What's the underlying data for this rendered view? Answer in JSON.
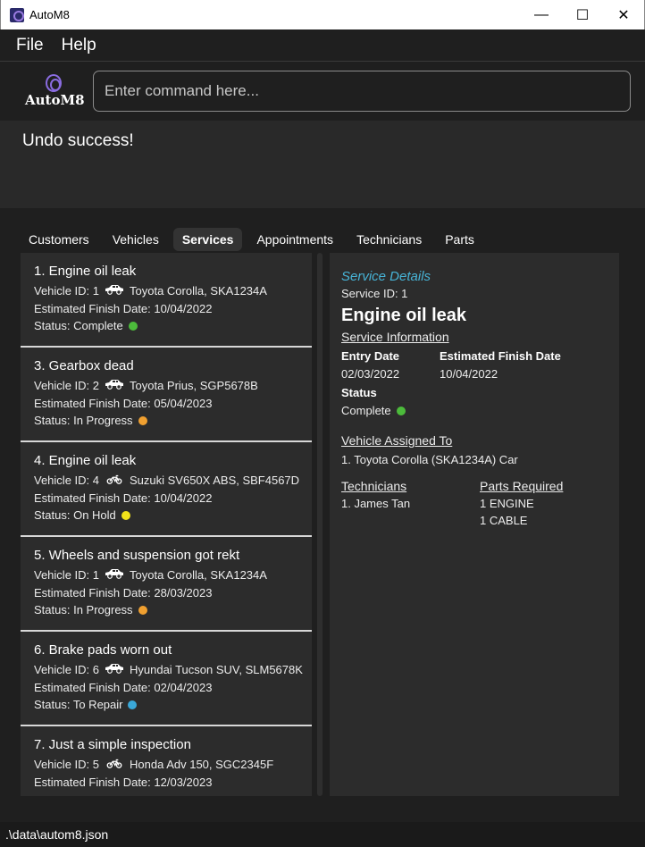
{
  "window": {
    "title": "AutoM8",
    "controls": [
      "—",
      "☐",
      "✕"
    ]
  },
  "menu": {
    "file": "File",
    "help": "Help"
  },
  "logo_text": "AutoM8",
  "command": {
    "placeholder": "Enter command here..."
  },
  "result": "Undo success!",
  "tabs": [
    "Customers",
    "Vehicles",
    "Services",
    "Appointments",
    "Technicians",
    "Parts"
  ],
  "active_tab": "Services",
  "services": [
    {
      "title": "1.  Engine oil leak",
      "vehicle": "Vehicle ID: 1",
      "vehicle_type": "car",
      "vehicle_name": "Toyota Corolla, SKA1234A",
      "finish": "Estimated Finish Date: 10/04/2022",
      "status": "Status: Complete",
      "status_color": "#4cbb3b"
    },
    {
      "title": "3.  Gearbox dead",
      "vehicle": "Vehicle ID: 2",
      "vehicle_type": "car",
      "vehicle_name": "Toyota Prius, SGP5678B",
      "finish": "Estimated Finish Date: 05/04/2023",
      "status": "Status: In Progress",
      "status_color": "#f0a030"
    },
    {
      "title": "4.  Engine oil leak",
      "vehicle": "Vehicle ID: 4",
      "vehicle_type": "bike",
      "vehicle_name": "Suzuki SV650X ABS, SBF4567D",
      "finish": "Estimated Finish Date: 10/04/2022",
      "status": "Status: On Hold",
      "status_color": "#f2e21a"
    },
    {
      "title": "5.  Wheels and suspension got rekt",
      "vehicle": "Vehicle ID: 1",
      "vehicle_type": "car",
      "vehicle_name": "Toyota Corolla, SKA1234A",
      "finish": "Estimated Finish Date: 28/03/2023",
      "status": "Status: In Progress",
      "status_color": "#f0a030"
    },
    {
      "title": "6.  Brake pads worn out",
      "vehicle": "Vehicle ID: 6",
      "vehicle_type": "car",
      "vehicle_name": "Hyundai Tucson SUV, SLM5678K",
      "finish": "Estimated Finish Date: 02/04/2023",
      "status": "Status: To Repair",
      "status_color": "#3aa8d8"
    },
    {
      "title": "7.  Just a simple inspection",
      "vehicle": "Vehicle ID: 5",
      "vehicle_type": "bike",
      "vehicle_name": "Honda Adv 150, SGC2345F",
      "finish": "Estimated Finish Date: 12/03/2023",
      "status": "",
      "status_color": ""
    }
  ],
  "details": {
    "header": "Service Details",
    "service_id": "Service ID: 1",
    "title": "Engine oil leak",
    "info_label": "Service Information",
    "entry_date_label": "Entry Date",
    "entry_date": "02/03/2022",
    "finish_label": "Estimated Finish Date",
    "finish_date": "10/04/2022",
    "status_label": "Status",
    "status": "Complete",
    "status_color": "#4cbb3b",
    "vehicle_label": "Vehicle Assigned To",
    "vehicle": "1. Toyota Corolla (SKA1234A) Car",
    "technicians_label": "Technicians",
    "technicians": [
      "1. James Tan"
    ],
    "parts_label": "Parts Required",
    "parts": [
      "1 ENGINE",
      "1 CABLE"
    ]
  },
  "statusbar": ".\\data\\autom8.json"
}
